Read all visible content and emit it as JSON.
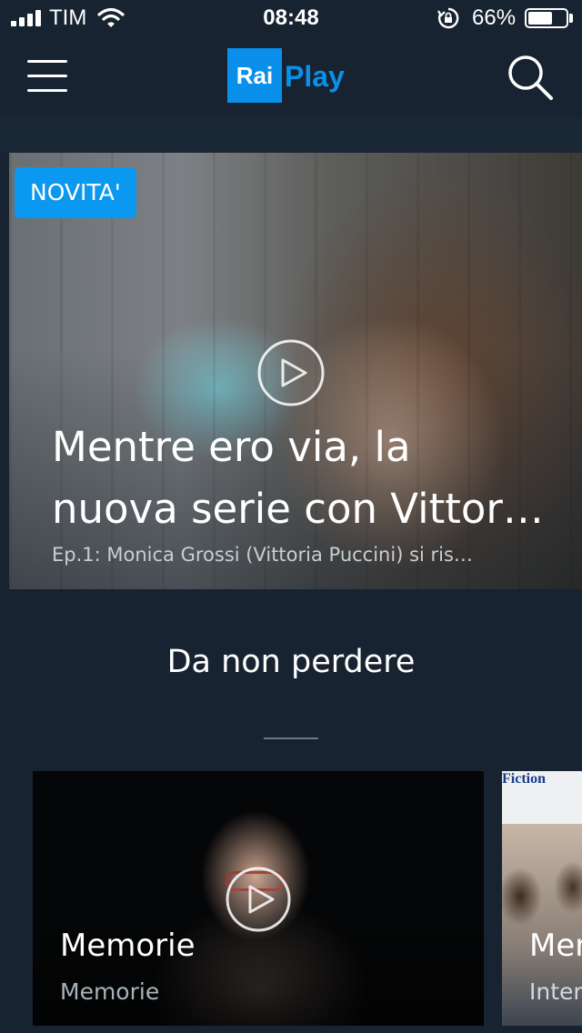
{
  "status_bar": {
    "carrier": "TIM",
    "time": "08:48",
    "battery_percent": "66%",
    "battery_level": 0.66,
    "icons": [
      "signal-icon",
      "wifi-icon",
      "rotation-lock-icon",
      "battery-icon"
    ]
  },
  "header": {
    "logo_rai": "Rai",
    "logo_play": "Play",
    "menu_icon": "hamburger-menu-icon",
    "search_icon": "search-icon"
  },
  "hero": {
    "badge": "NOVITA'",
    "title_line1": "Mentre ero via, la",
    "title_line2": "nuova serie con Vittor…",
    "subtitle": "Ep.1: Monica Grossi (Vittoria Puccini) si ris…",
    "play_icon": "play-circle-icon"
  },
  "section": {
    "title": "Da non perdere"
  },
  "cards": [
    {
      "title": "Memorie",
      "subtitle": "Memorie"
    },
    {
      "brand": "Fiction",
      "title": "Mer",
      "subtitle": "Inter"
    }
  ],
  "colors": {
    "background": "#172330",
    "accent": "#0a98f0"
  }
}
